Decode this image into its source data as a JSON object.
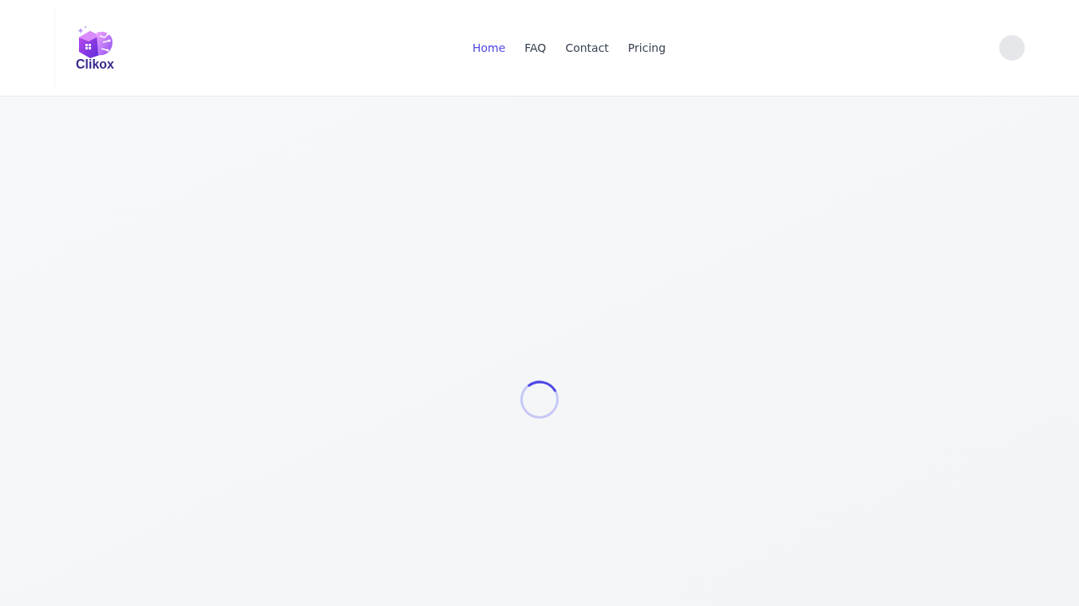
{
  "header": {
    "logo": {
      "text": "Clikox"
    },
    "nav": [
      {
        "label": "Home",
        "selected": true
      },
      {
        "label": "FAQ",
        "selected": false
      },
      {
        "label": "Contact",
        "selected": false
      },
      {
        "label": "Pricing",
        "selected": false
      }
    ]
  },
  "main": {
    "loading": true
  }
}
